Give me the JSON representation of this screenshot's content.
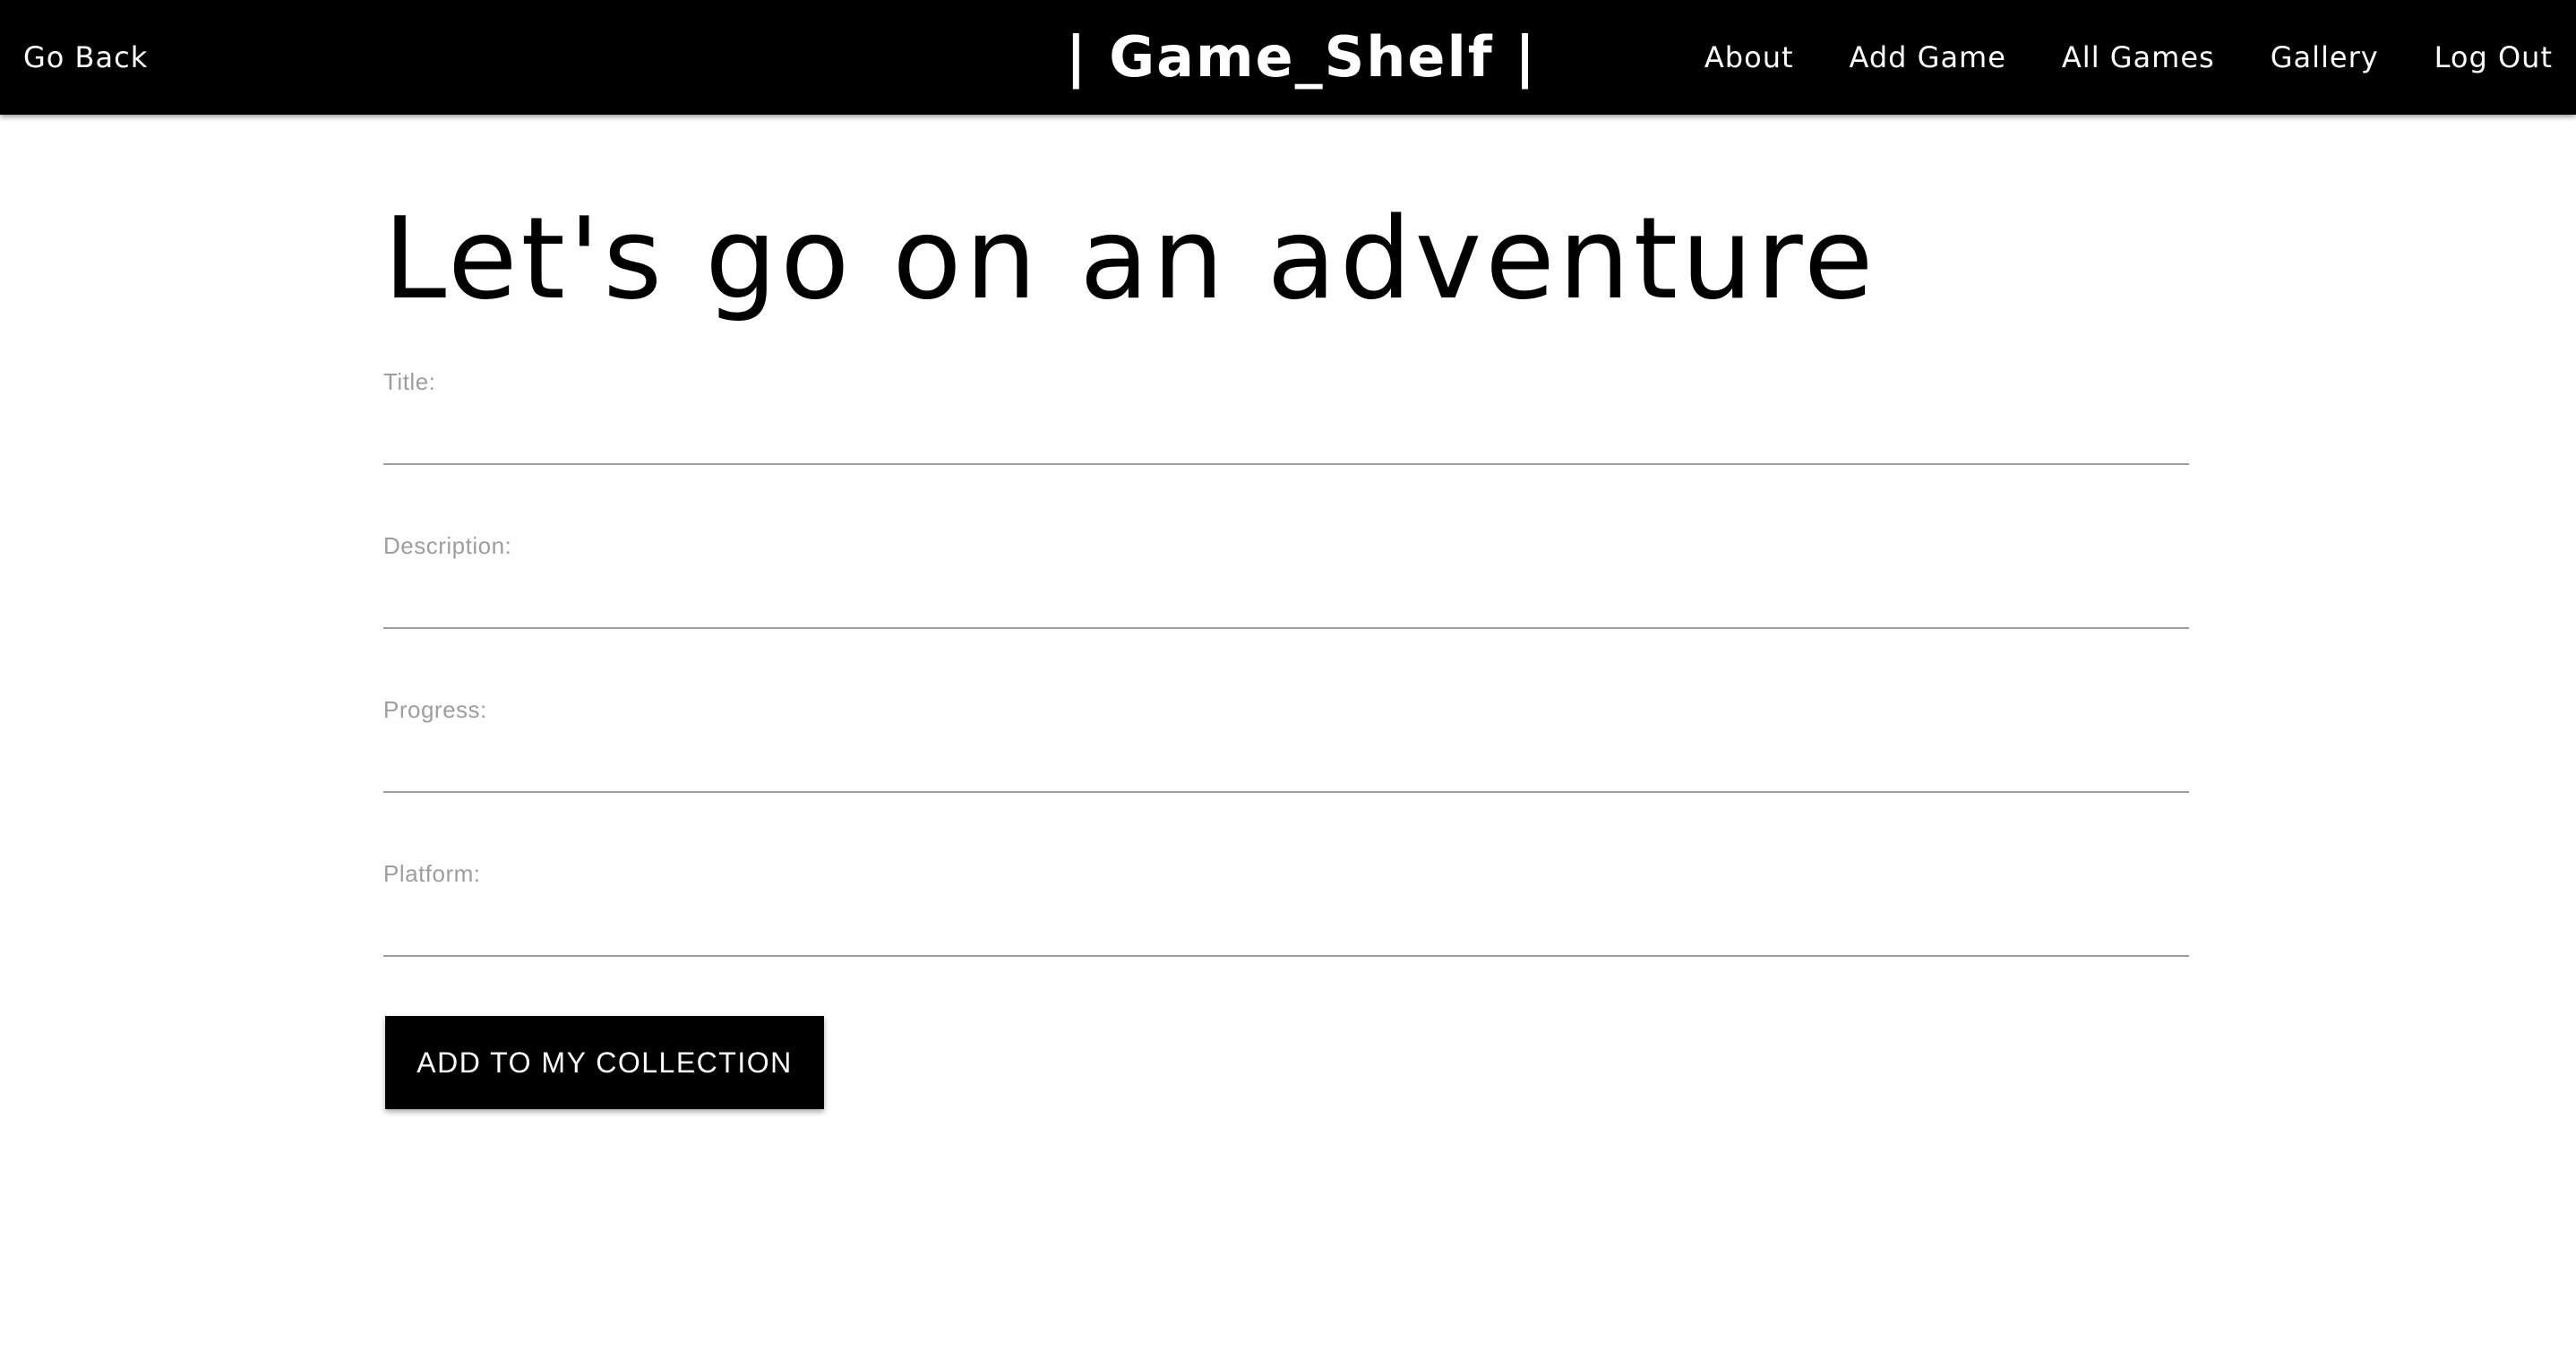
{
  "navbar": {
    "back_label": "Go Back",
    "brand": "| Game_Shelf |",
    "links": [
      "About",
      "Add Game",
      "All Games",
      "Gallery",
      "Log Out"
    ]
  },
  "main": {
    "heading": "Let's go on an adventure",
    "fields": {
      "title": {
        "label": "Title:",
        "value": ""
      },
      "description": {
        "label": "Description:",
        "value": ""
      },
      "progress": {
        "label": "Progress:",
        "value": ""
      },
      "platform": {
        "label": "Platform:",
        "value": ""
      }
    },
    "submit_label": "ADD TO MY COLLECTION"
  },
  "colors": {
    "navbar_bg": "#000000",
    "nav_text": "#ffffff",
    "label_gray": "#9e9e9e",
    "button_bg": "#000000"
  }
}
